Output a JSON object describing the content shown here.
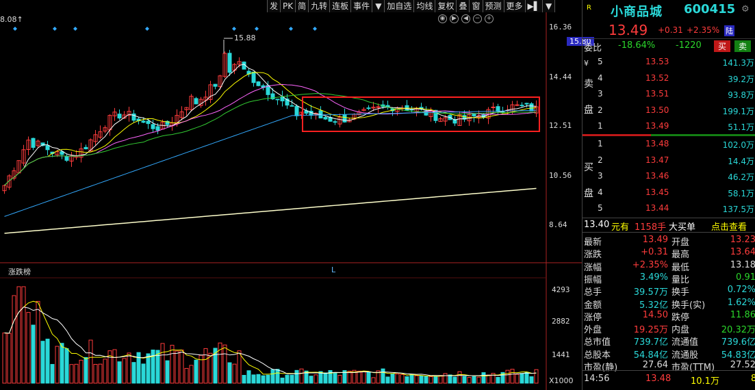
{
  "toolbar": {
    "items": [
      "发",
      "PK",
      "简",
      "九转",
      "连板",
      "事件",
      "▼",
      "加自选",
      "均线",
      "复权",
      "叠",
      "窗",
      "预测",
      "更多",
      "▶▌",
      "▼"
    ]
  },
  "chart": {
    "left_label": "8.08↑",
    "max_label": "15.88",
    "y_labels": [
      "16.36",
      "14.44",
      "12.51",
      "10.56",
      "8.64"
    ],
    "y_highlight": "15.80",
    "vol_title": "涨跌榜",
    "vol_marker": "L",
    "vol_y_labels": [
      "4293",
      "2882",
      "1441"
    ],
    "vol_unit": "X1000",
    "colors": {
      "up": "#ff3c3c",
      "down": "#2ad8d8",
      "ma5": "#ffffff",
      "ma10": "#ffff00",
      "ma20": "#ff66ff",
      "ma30": "#33cc33",
      "ma60": "#33aaff",
      "ma250": "#ffffcc",
      "box": "#ff2020"
    }
  },
  "chart_data": {
    "type": "candlestick",
    "ylim": [
      8.64,
      16.36
    ],
    "ticks": [
      16.36,
      14.44,
      12.51,
      10.56,
      8.64
    ],
    "max_price": 15.88,
    "box_range": [
      12.4,
      13.6
    ],
    "volume_ylim": [
      0,
      5000
    ],
    "volume_ticks": [
      4293,
      2882,
      1441
    ]
  },
  "panel": {
    "flag": "R",
    "name": "小商品城",
    "code": "600415",
    "menu_icon": "⚙",
    "price": "13.49",
    "change": "+0.31",
    "pct": "+2.35%",
    "tag": "陆",
    "weibi_label": "委比",
    "weibi": "-18.64%",
    "weicha": "-1220",
    "buy_btn": "买",
    "sell_btn": "卖",
    "sell_side": "卖盘",
    "buy_side": "买盘",
    "sell_orders": [
      {
        "n": "5",
        "p": "13.53",
        "v": "141.3万"
      },
      {
        "n": "4",
        "p": "13.52",
        "v": "39.2万"
      },
      {
        "n": "3",
        "p": "13.51",
        "v": "93.8万"
      },
      {
        "n": "2",
        "p": "13.50",
        "v": "199.1万"
      },
      {
        "n": "1",
        "p": "13.49",
        "v": "51.1万"
      }
    ],
    "buy_orders": [
      {
        "n": "1",
        "p": "13.48",
        "v": "102.0万"
      },
      {
        "n": "2",
        "p": "13.47",
        "v": "14.4万"
      },
      {
        "n": "3",
        "p": "13.46",
        "v": "46.2万"
      },
      {
        "n": "4",
        "p": "13.45",
        "v": "58.1万"
      },
      {
        "n": "5",
        "p": "13.44",
        "v": "137.5万"
      }
    ],
    "info": {
      "price": "13.40",
      "unit1": "元有",
      "qty": "1158手",
      "big": "大买单",
      "link": "点击查看"
    },
    "stats": [
      {
        "l1": "最新",
        "v1": "13.49",
        "c1": "red",
        "l2": "开盘",
        "v2": "13.23",
        "c2": "red"
      },
      {
        "l1": "涨跌",
        "v1": "+0.31",
        "c1": "red",
        "l2": "最高",
        "v2": "13.64",
        "c2": "red"
      },
      {
        "l1": "涨幅",
        "v1": "+2.35%",
        "c1": "red",
        "l2": "最低",
        "v2": "13.18",
        "c2": "wh"
      },
      {
        "l1": "振幅",
        "v1": "3.49%",
        "c1": "cy",
        "l2": "量比",
        "v2": "0.91",
        "c2": "grn"
      },
      {
        "l1": "总手",
        "v1": "39.57万",
        "c1": "cy",
        "l2": "换手",
        "v2": "0.72%",
        "c2": "cy"
      },
      {
        "l1": "金额",
        "v1": "5.32亿",
        "c1": "cy",
        "l2": "换手(实)",
        "v2": "1.62%",
        "c2": "cy"
      },
      {
        "l1": "涨停",
        "v1": "14.50",
        "c1": "red",
        "l2": "跌停",
        "v2": "11.86",
        "c2": "grn"
      },
      {
        "l1": "外盘",
        "v1": "19.25万",
        "c1": "red",
        "l2": "内盘",
        "v2": "20.32万",
        "c2": "grn"
      },
      {
        "l1": "总市值",
        "v1": "739.7亿",
        "c1": "cy",
        "l2": "流通值",
        "v2": "739.6亿",
        "c2": "cy"
      },
      {
        "l1": "总股本",
        "v1": "54.84亿",
        "c1": "cy",
        "l2": "流通股",
        "v2": "54.83亿",
        "c2": "cy"
      },
      {
        "l1": "市盈(静)",
        "v1": "27.64",
        "c1": "wh",
        "l2": "市盈(TTM)",
        "v2": "27.52",
        "c2": "wh"
      }
    ],
    "tick": {
      "time": "14:56",
      "price": "13.48",
      "vol": "10.1万",
      "n": "8"
    }
  }
}
